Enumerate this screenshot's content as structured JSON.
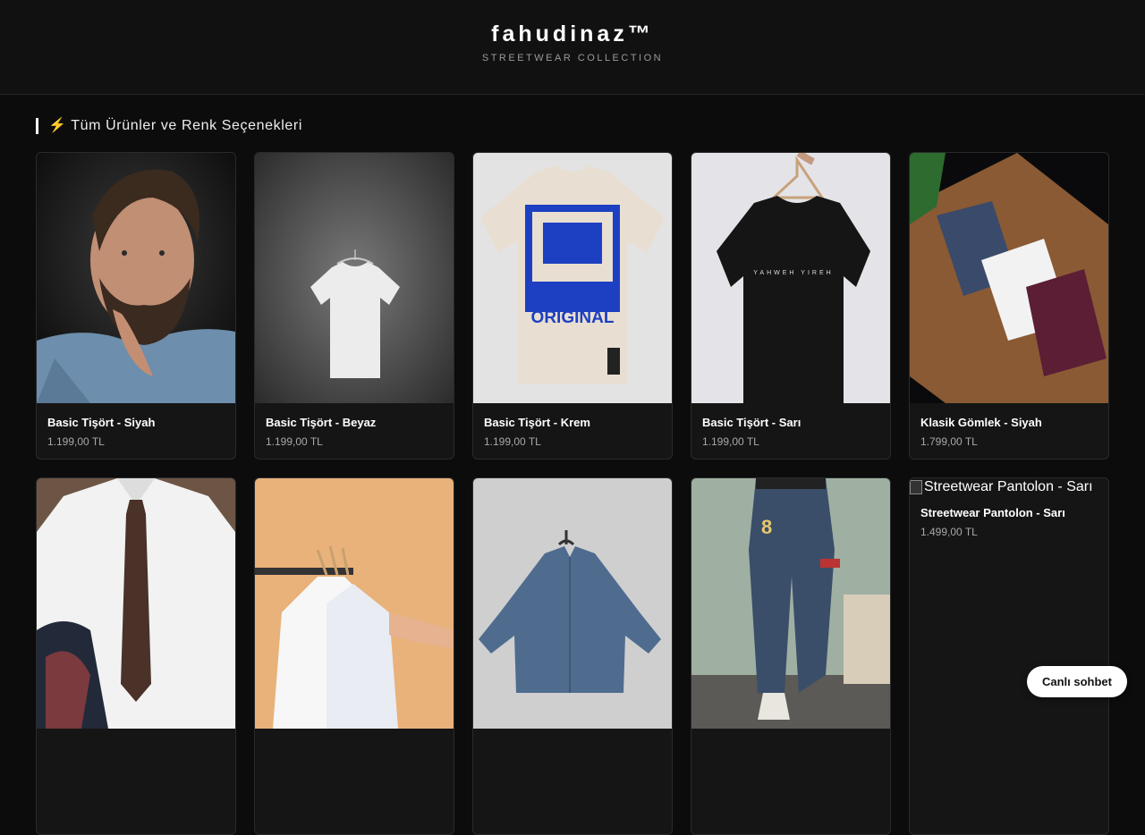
{
  "header": {
    "brand": "fahudinaz™",
    "tagline": "STREETWEAR COLLECTION"
  },
  "section": {
    "title": "⚡ Tüm Ürünler ve Renk Seçenekleri"
  },
  "products": [
    {
      "name": "Basic Tişört - Siyah",
      "price": "1.199,00 TL",
      "image": "bearded-man-denim-shirt"
    },
    {
      "name": "Basic Tişört - Beyaz",
      "price": "1.199,00 TL",
      "image": "white-tshirt-on-hanger"
    },
    {
      "name": "Basic Tişört - Krem",
      "price": "1.199,00 TL",
      "image": "cream-tshirt-original-print"
    },
    {
      "name": "Basic Tişört - Sarı",
      "price": "1.199,00 TL",
      "image": "black-tshirt-on-hanger"
    },
    {
      "name": "Klasik Gömlek - Siyah",
      "price": "1.799,00 TL",
      "image": "folded-shirts-on-table"
    },
    {
      "name": "",
      "price": "",
      "image": "man-white-shirt-tie"
    },
    {
      "name": "",
      "price": "",
      "image": "white-shirts-on-rack"
    },
    {
      "name": "",
      "price": "",
      "image": "denim-shirt-on-hanger"
    },
    {
      "name": "",
      "price": "",
      "image": "ripped-jeans-walking"
    },
    {
      "name": "Streetwear Pantolon - Sarı",
      "price": "1.499,00 TL",
      "image_alt": "Streetwear Pantolon - Sarı"
    }
  ],
  "chat": {
    "label": "Canlı sohbet"
  },
  "colors": {
    "background": "#0c0c0c",
    "header": "#111111",
    "card": "#151515"
  }
}
